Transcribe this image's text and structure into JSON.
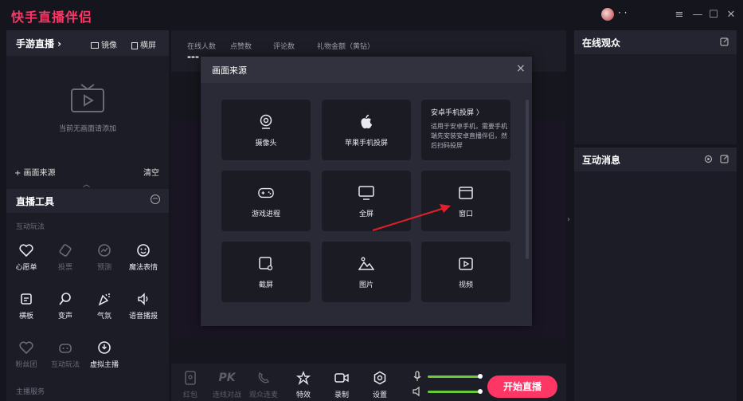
{
  "app": {
    "title": "快手直播伴侣",
    "username": "· ·"
  },
  "window_controls": {
    "menu": "≡",
    "minimize": "—",
    "maximize": "☐",
    "close": "✕"
  },
  "left_panel": {
    "header": {
      "title": "手游直播 ›",
      "mirror": "镜像",
      "landscape": "横屏"
    },
    "empty_text": "当前无画面请添加",
    "add_source": "+ 画面来源",
    "clear": "清空",
    "collapse": "︿",
    "tools": {
      "title": "直播工具",
      "minus": "−",
      "section_interactive": "互动玩法",
      "section_host": "主播服务",
      "items": [
        {
          "label": "心愿单",
          "icon": "heart-wish-icon",
          "enabled": true
        },
        {
          "label": "投票",
          "icon": "ticket-icon",
          "enabled": false
        },
        {
          "label": "预测",
          "icon": "predict-icon",
          "enabled": false
        },
        {
          "label": "魔法表情",
          "icon": "smile-icon",
          "enabled": true
        },
        {
          "label": "横板",
          "icon": "board-icon",
          "enabled": true
        },
        {
          "label": "变声",
          "icon": "voice-change-icon",
          "enabled": true
        },
        {
          "label": "气氛",
          "icon": "party-icon",
          "enabled": true
        },
        {
          "label": "语音播报",
          "icon": "speaker-icon",
          "enabled": true
        },
        {
          "label": "粉丝团",
          "icon": "fan-heart-icon",
          "enabled": false
        },
        {
          "label": "互动玩法",
          "icon": "gamepad-icon",
          "enabled": false
        },
        {
          "label": "虚拟主播",
          "icon": "virtual-host-icon",
          "enabled": true
        }
      ]
    }
  },
  "stats": {
    "online": "在线人数",
    "likes": "点赞数",
    "comments": "评论数",
    "gift_amount": "礼物金额（黄钻）",
    "online_value": "---"
  },
  "bottom_bar": {
    "items": [
      {
        "label": "红包",
        "icon": "red-packet-icon",
        "enabled": false
      },
      {
        "label": "连线对战",
        "icon": "pk-icon",
        "enabled": false
      },
      {
        "label": "观众连麦",
        "icon": "audience-mic-icon",
        "enabled": false
      },
      {
        "label": "特效",
        "icon": "effects-icon",
        "enabled": true
      },
      {
        "label": "录制",
        "icon": "record-icon",
        "enabled": true
      },
      {
        "label": "设置",
        "icon": "settings-icon",
        "enabled": true
      }
    ],
    "mic_level": 1.0,
    "speaker_level": 1.0,
    "start_button": "开始直播"
  },
  "right_panel": {
    "audience_title": "在线观众",
    "messages_title": "互动消息"
  },
  "modal": {
    "title": "画面来源",
    "close": "×",
    "tiles": [
      {
        "label": "摄像头",
        "icon": "webcam-icon"
      },
      {
        "label": "苹果手机投屏",
        "icon": "apple-icon"
      },
      {
        "label": "游戏进程",
        "icon": "gamepad-icon"
      },
      {
        "label": "全屏",
        "icon": "monitor-icon"
      },
      {
        "label": "窗口",
        "icon": "window-icon"
      },
      {
        "label": "截屏",
        "icon": "screenshot-icon"
      },
      {
        "label": "图片",
        "icon": "image-icon"
      },
      {
        "label": "视频",
        "icon": "video-icon"
      }
    ],
    "android": {
      "title": "安卓手机投屏 〉",
      "description": "适用于安卓手机，需要手机端先安装安卓直播伴侣，然后扫码投屏"
    }
  },
  "colors": {
    "accent": "#fe3666",
    "slider": "#6acb3a",
    "background": "#15151d",
    "panel": "#1c1c26"
  }
}
